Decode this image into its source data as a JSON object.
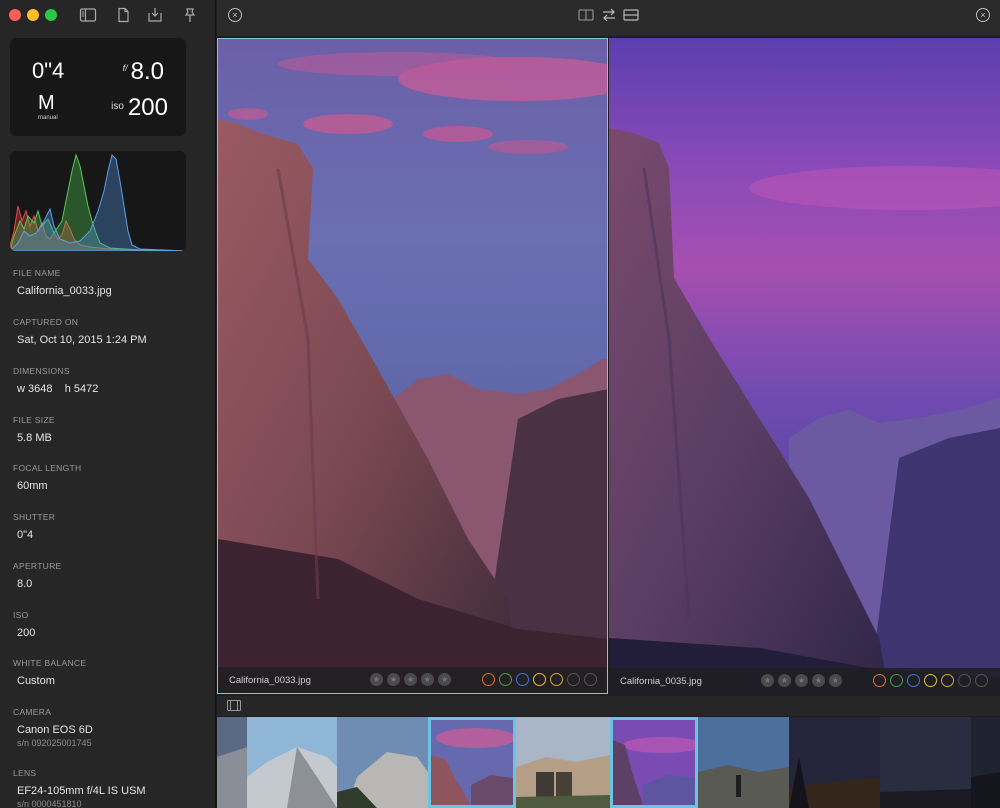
{
  "colors": {
    "accent": "#6cc4e2",
    "sidebar_bg": "#262627",
    "label_colors": [
      "#e0712a",
      "#3fa047",
      "#3a7bd5",
      "#e6c32a",
      "#d4a92a",
      "#555555",
      "#555555"
    ]
  },
  "toolbar": {
    "icons": [
      "sidebar-toggle-icon",
      "document-icon",
      "import-icon",
      "pin-icon"
    ]
  },
  "exif": {
    "shutter": "0\"4",
    "fstop_prefix": "f/",
    "fstop": "8.0",
    "mode": "M",
    "mode_sub": "manual",
    "iso_prefix": "iso",
    "iso": "200"
  },
  "metadata": {
    "file_name": {
      "label": "FILE NAME",
      "value": "California_0033.jpg"
    },
    "captured_on": {
      "label": "CAPTURED ON",
      "value": "Sat, Oct 10, 2015 1:24 PM"
    },
    "dimensions": {
      "label": "DIMENSIONS",
      "value": "w 3648    h 5472"
    },
    "file_size": {
      "label": "FILE SIZE",
      "value": "5.8 MB"
    },
    "focal_length": {
      "label": "FOCAL LENGTH",
      "value": "60mm"
    },
    "shutter": {
      "label": "SHUTTER",
      "value": "0\"4"
    },
    "aperture": {
      "label": "APERTURE",
      "value": "8.0"
    },
    "iso": {
      "label": "ISO",
      "value": "200"
    },
    "white_balance": {
      "label": "WHITE BALANCE",
      "value": "Custom"
    },
    "camera": {
      "label": "CAMERA",
      "value": "Canon EOS 6D",
      "sub": "s/n 092025001745"
    },
    "lens": {
      "label": "LENS",
      "value": "EF24-105mm f/4L IS USM",
      "sub": "s/n 0000451810"
    }
  },
  "compare": {
    "left": {
      "name": "California_0033.jpg",
      "stars": 5
    },
    "right": {
      "name": "California_0035.jpg",
      "stars": 5
    }
  },
  "topbar": {
    "close_left": "×",
    "close_right": "×"
  }
}
